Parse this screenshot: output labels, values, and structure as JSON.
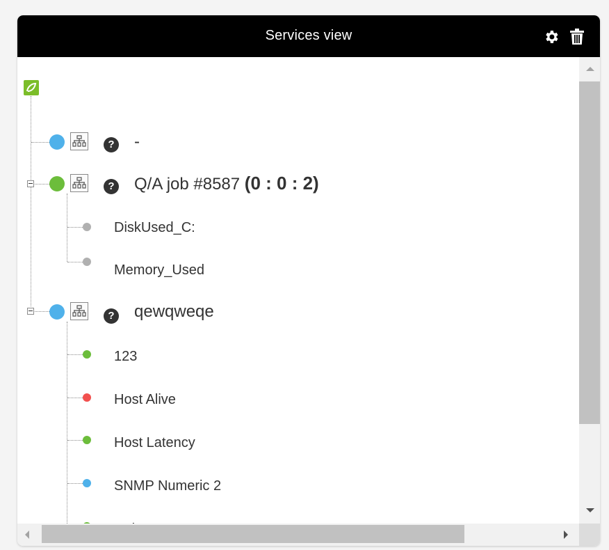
{
  "header": {
    "title": "Services view",
    "icons": [
      "gear-icon",
      "trash-icon"
    ]
  },
  "tree": {
    "root_icon": "root-service-icon",
    "services": [
      {
        "label": "-",
        "status_color": "#4fb1ea",
        "counts": "",
        "expanded": false,
        "modules": []
      },
      {
        "label": "Q/A job #8587",
        "status_color": "#6cbd3b",
        "counts": "(0 : 0 : 2)",
        "expanded": true,
        "modules": [
          {
            "label": "DiskUsed_C:",
            "status_color": "#b0b0b0"
          },
          {
            "label": "Memory_Used",
            "status_color": "#b0b0b0"
          }
        ]
      },
      {
        "label": "qewqweqe",
        "status_color": "#4fb1ea",
        "counts": "",
        "expanded": true,
        "modules": [
          {
            "label": "123",
            "status_color": "#6cbd3b"
          },
          {
            "label": "Host Alive",
            "status_color": "#f2504e"
          },
          {
            "label": "Host Latency",
            "status_color": "#6cbd3b"
          },
          {
            "label": "SNMP Numeric 2",
            "status_color": "#4fb1ea"
          },
          {
            "label": "webserver",
            "status_color": "#6cbd3b"
          }
        ]
      }
    ],
    "question_mark": "?"
  },
  "colors": {
    "header_bg": "#000000",
    "root_green": "#7bbd29",
    "scrollbar_thumb": "#c1c1c1"
  }
}
